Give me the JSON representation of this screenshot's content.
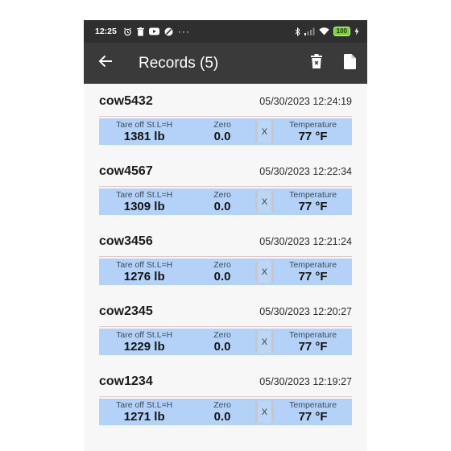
{
  "status_bar": {
    "time": "12:25",
    "battery": "100",
    "more": "···"
  },
  "app_bar": {
    "title": "Records (5)",
    "back_icon": "arrow-left-icon",
    "delete_icon": "trash-icon",
    "export_icon": "file-icon"
  },
  "records": [
    {
      "name": "cow5432",
      "timestamp": "05/30/2023 12:24:19",
      "tare_label": "Tare off St.L=H",
      "weight": "1381 lb",
      "zero_label": "Zero",
      "zero": "0.0",
      "x": "X",
      "temp_label": "Temperature",
      "temp": "77 °F"
    },
    {
      "name": "cow4567",
      "timestamp": "05/30/2023 12:22:34",
      "tare_label": "Tare off St.L=H",
      "weight": "1309 lb",
      "zero_label": "Zero",
      "zero": "0.0",
      "x": "X",
      "temp_label": "Temperature",
      "temp": "77 °F"
    },
    {
      "name": "cow3456",
      "timestamp": "05/30/2023 12:21:24",
      "tare_label": "Tare off St.L=H",
      "weight": "1276 lb",
      "zero_label": "Zero",
      "zero": "0.0",
      "x": "X",
      "temp_label": "Temperature",
      "temp": "77 °F"
    },
    {
      "name": "cow2345",
      "timestamp": "05/30/2023 12:20:27",
      "tare_label": "Tare off St.L=H",
      "weight": "1229 lb",
      "zero_label": "Zero",
      "zero": "0.0",
      "x": "X",
      "temp_label": "Temperature",
      "temp": "77 °F"
    },
    {
      "name": "cow1234",
      "timestamp": "05/30/2023 12:19:27",
      "tare_label": "Tare off St.L=H",
      "weight": "1271 lb",
      "zero_label": "Zero",
      "zero": "0.0",
      "x": "X",
      "temp_label": "Temperature",
      "temp": "77 °F"
    }
  ],
  "colors": {
    "app_bar": "#3a3a3a",
    "status_bar": "#2f2f2f",
    "strip": "#b4d2f7",
    "battery": "#7cd13c"
  }
}
